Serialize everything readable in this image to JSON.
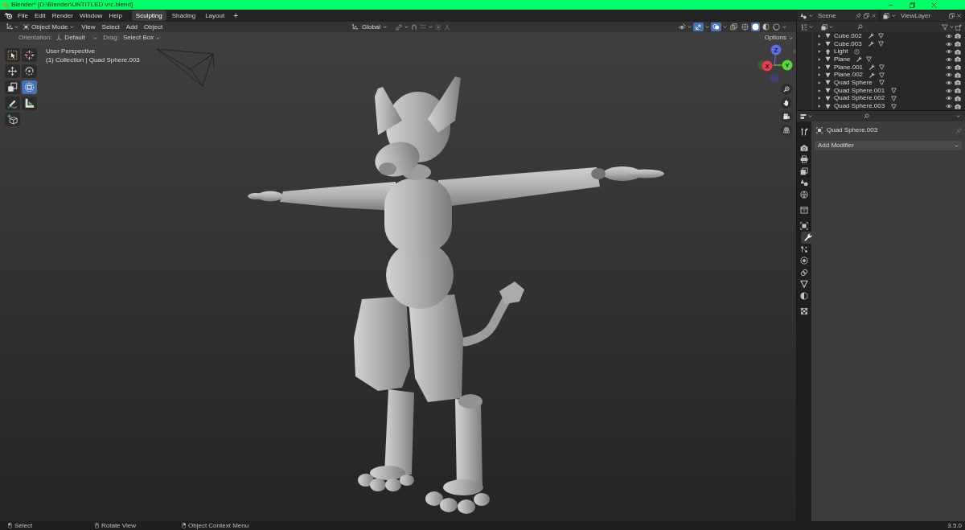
{
  "window": {
    "title": "Blender* [D:\\Blender\\UNTITLED vrc.blend]"
  },
  "top_bar": {
    "menus": [
      "File",
      "Edit",
      "Render",
      "Window",
      "Help"
    ],
    "workspace_tabs": [
      {
        "label": "Sculpting",
        "selected": true
      },
      {
        "label": "Shading",
        "selected": false
      },
      {
        "label": "Layout",
        "selected": false
      }
    ],
    "add_workspace": "+",
    "scene": "Scene",
    "view_layer": "ViewLayer"
  },
  "viewport": {
    "mode": "Object Mode",
    "menus": [
      "View",
      "Select",
      "Add",
      "Object"
    ],
    "transform_orientation": "Global",
    "snapping": false,
    "proportional_editing": false,
    "header_toggles": [
      {
        "kind": "gizmos",
        "on": true
      },
      {
        "kind": "overlays",
        "on": true
      },
      {
        "kind": "xray",
        "on": false
      }
    ],
    "shading_modes": [
      {
        "kind": "wireframe",
        "selected": false
      },
      {
        "kind": "solid",
        "selected": true
      },
      {
        "kind": "material",
        "selected": false
      },
      {
        "kind": "rendered",
        "selected": false
      }
    ],
    "tool_settings": [
      {
        "kind": "orientation",
        "label": "Orientation:",
        "value": "Default"
      },
      {
        "kind": "drag",
        "label": "Drag:",
        "value": "Select Box"
      }
    ],
    "options": "Options",
    "tools": [
      {
        "kind": "select-box",
        "selected": false
      },
      {
        "kind": "cursor",
        "selected": false
      },
      {
        "kind": "move",
        "selected": false
      },
      {
        "kind": "rotate",
        "selected": false
      },
      {
        "kind": "scale",
        "selected": false
      },
      {
        "kind": "transform",
        "selected": true
      },
      {
        "kind": "annotate",
        "selected": false
      },
      {
        "kind": "measure",
        "selected": false
      },
      {
        "kind": "add-cube",
        "selected": false
      }
    ],
    "info": {
      "view": "User Perspective",
      "context": "(1) Collection | Quad Sphere.003"
    },
    "gizmo": {
      "axes": [
        {
          "label": "Z",
          "color": "#5a6fe0"
        },
        {
          "label": "X",
          "color": "#ee3a51"
        },
        {
          "label": "Y",
          "color": "#55d93b"
        }
      ]
    }
  },
  "outliner": {
    "items": [
      {
        "name": "Cube.002",
        "kind": "mesh",
        "modifiers": true,
        "expanded": false,
        "visible": true,
        "renderable": true
      },
      {
        "name": "Cube.003",
        "kind": "mesh",
        "modifiers": true,
        "expanded": false,
        "visible": true,
        "renderable": true
      },
      {
        "name": "Light",
        "kind": "light",
        "modifiers": false,
        "expanded": false,
        "visible": true,
        "renderable": true
      },
      {
        "name": "Plane",
        "kind": "mesh",
        "modifiers": true,
        "expanded": false,
        "visible": true,
        "renderable": true
      },
      {
        "name": "Plane.001",
        "kind": "mesh",
        "modifiers": true,
        "expanded": false,
        "visible": true,
        "renderable": true
      },
      {
        "name": "Plane.002",
        "kind": "mesh",
        "modifiers": true,
        "expanded": false,
        "visible": true,
        "renderable": true
      },
      {
        "name": "Quad Sphere",
        "kind": "mesh",
        "modifiers": false,
        "expanded": false,
        "visible": true,
        "renderable": true
      },
      {
        "name": "Quad Sphere.001",
        "kind": "mesh",
        "modifiers": false,
        "expanded": false,
        "visible": true,
        "renderable": true
      },
      {
        "name": "Quad Sphere.002",
        "kind": "mesh",
        "modifiers": false,
        "expanded": false,
        "visible": true,
        "renderable": true
      },
      {
        "name": "Quad Sphere.003",
        "kind": "mesh",
        "modifiers": false,
        "expanded": false,
        "visible": true,
        "renderable": true
      }
    ]
  },
  "properties": {
    "tabs": [
      {
        "kind": "tool",
        "selected": false
      },
      {
        "kind": "render",
        "selected": false
      },
      {
        "kind": "output",
        "selected": false
      },
      {
        "kind": "view-layer",
        "selected": false
      },
      {
        "kind": "scene",
        "selected": false
      },
      {
        "kind": "world",
        "selected": false
      },
      {
        "kind": "collection",
        "selected": false
      },
      {
        "kind": "object",
        "selected": false
      },
      {
        "kind": "modifiers",
        "selected": true
      },
      {
        "kind": "particles",
        "selected": false
      },
      {
        "kind": "physics",
        "selected": false
      },
      {
        "kind": "constraints",
        "selected": false
      },
      {
        "kind": "data",
        "selected": false
      },
      {
        "kind": "material",
        "selected": false
      },
      {
        "kind": "texture",
        "selected": false
      }
    ],
    "object_name": "Quad Sphere.003",
    "add_modifier": "Add Modifier"
  },
  "status_bar": {
    "hints": [
      {
        "kind": "left-click",
        "label": "Select"
      },
      {
        "kind": "middle-click",
        "label": "Rotate View"
      },
      {
        "kind": "right-click",
        "label": "Object Context Menu"
      }
    ],
    "version": "3.5.0"
  }
}
